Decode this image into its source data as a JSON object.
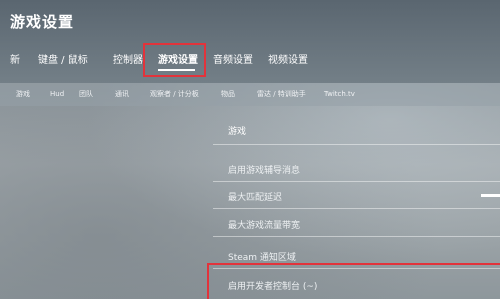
{
  "window": {
    "title": "游戏设置"
  },
  "top_tabs": [
    "新",
    "键盘 / 鼠标",
    "控制器",
    "游戏设置",
    "音频设置",
    "视频设置"
  ],
  "sub_tabs": [
    "游戏",
    "Hud",
    "团队",
    "通讯",
    "观察者 / 计分板",
    "物品",
    "雷达 / 特训助手",
    "Twitch.tv"
  ],
  "section": {
    "title": "游戏",
    "options": [
      "启用游戏辅导消息",
      "最大匹配延迟",
      "最大游戏流量带宽",
      "Steam 通知区域",
      "启用开发者控制台 (~)"
    ]
  },
  "colors": {
    "highlight_box": "#e2333b",
    "header_bg": "#5a6670",
    "text": "#ffffff"
  }
}
